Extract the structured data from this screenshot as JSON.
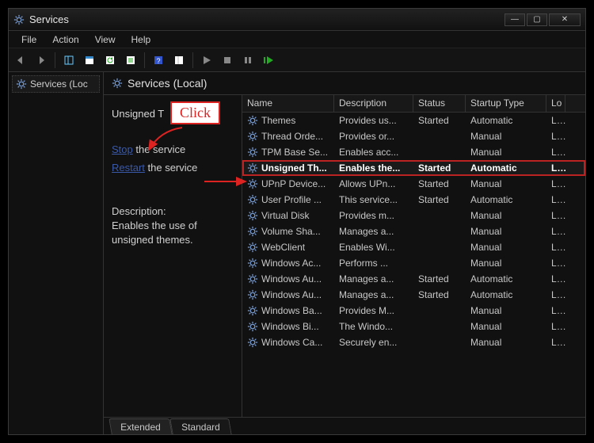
{
  "window": {
    "title": "Services"
  },
  "menu": {
    "file": "File",
    "action": "Action",
    "view": "View",
    "help": "Help"
  },
  "tree": {
    "root": "Services (Loc"
  },
  "main": {
    "header": "Services (Local)"
  },
  "side": {
    "service_name": "Unsigned T",
    "stop_link": "Stop",
    "stop_rest": " the service",
    "restart_link": "Restart",
    "restart_rest": " the service",
    "desc_hd": "Description:",
    "desc_body": "Enables the use of unsigned themes."
  },
  "columns": {
    "name": "Name",
    "desc": "Description",
    "status": "Status",
    "startup": "Startup Type",
    "logon": "Lo"
  },
  "services": [
    {
      "name": "Themes",
      "desc": "Provides us...",
      "status": "Started",
      "startup": "Automatic",
      "logon": "Lc"
    },
    {
      "name": "Thread Orde...",
      "desc": "Provides or...",
      "status": "",
      "startup": "Manual",
      "logon": "Lc"
    },
    {
      "name": "TPM Base Se...",
      "desc": "Enables acc...",
      "status": "",
      "startup": "Manual",
      "logon": "Lc"
    },
    {
      "name": "Unsigned Th...",
      "desc": "Enables the...",
      "status": "Started",
      "startup": "Automatic",
      "logon": "Lc",
      "selected": true
    },
    {
      "name": "UPnP Device...",
      "desc": "Allows UPn...",
      "status": "Started",
      "startup": "Manual",
      "logon": "Lc"
    },
    {
      "name": "User Profile ...",
      "desc": "This service...",
      "status": "Started",
      "startup": "Automatic",
      "logon": "Lc"
    },
    {
      "name": "Virtual Disk",
      "desc": "Provides m...",
      "status": "",
      "startup": "Manual",
      "logon": "Lc"
    },
    {
      "name": "Volume Sha...",
      "desc": "Manages a...",
      "status": "",
      "startup": "Manual",
      "logon": "Lc"
    },
    {
      "name": "WebClient",
      "desc": "Enables Wi...",
      "status": "",
      "startup": "Manual",
      "logon": "Lc"
    },
    {
      "name": "Windows Ac...",
      "desc": "Performs ...",
      "status": "",
      "startup": "Manual",
      "logon": "Lc"
    },
    {
      "name": "Windows Au...",
      "desc": "Manages a...",
      "status": "Started",
      "startup": "Automatic",
      "logon": "Lc"
    },
    {
      "name": "Windows Au...",
      "desc": "Manages a...",
      "status": "Started",
      "startup": "Automatic",
      "logon": "Lc"
    },
    {
      "name": "Windows Ba...",
      "desc": "Provides M...",
      "status": "",
      "startup": "Manual",
      "logon": "Lc"
    },
    {
      "name": "Windows Bi...",
      "desc": "The Windo...",
      "status": "",
      "startup": "Manual",
      "logon": "Lc"
    },
    {
      "name": "Windows Ca...",
      "desc": "Securely en...",
      "status": "",
      "startup": "Manual",
      "logon": "Lc"
    }
  ],
  "tabs": {
    "extended": "Extended",
    "standard": "Standard"
  },
  "annotation": {
    "click": "Click"
  }
}
